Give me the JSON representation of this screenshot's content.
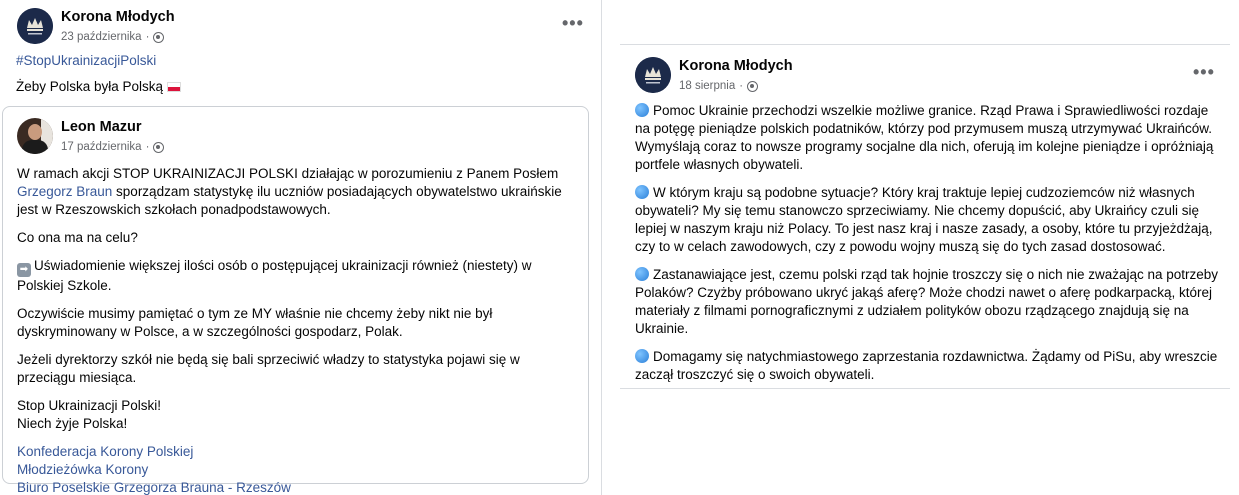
{
  "left_post": {
    "page_name": "Korona Młodych",
    "date": "23 października",
    "more_options": "•••",
    "hashtag": "#StopUkrainizacjiPolski",
    "caption": "Żeby Polska była Polską",
    "shared": {
      "author": "Leon Mazur",
      "date": "17 października",
      "p1_a": "W ramach akcji STOP UKRAINIZACJI POLSKI działając w porozumieniu z Panem Posłem",
      "p1_link": "Grzegorz Braun",
      "p1_b": " sporządzam statystykę ilu uczniów posiadających obywatelstwo ukraińskie jest w Rzeszowskich szkołach ponadpodstawowych.",
      "p2": "Co ona ma na celu?",
      "p3": "Uświadomienie większej ilości osób o postępującej ukrainizacji również (niestety) w Polskiej Szkole.",
      "p4": "Oczywiście musimy pamiętać o tym ze MY właśnie nie chcemy żeby nikt nie był dyskryminowany w Polsce, a w szczególności gospodarz, Polak.",
      "p5": "Jeżeli dyrektorzy szkół nie będą się bali sprzeciwić władzy to statystyka pojawi się w przeciągu miesiąca.",
      "p6a": "Stop Ukrainizacji Polski!",
      "p6b": "Niech żyje Polska!",
      "links": [
        "Konfederacja Korony Polskiej",
        "Młodzieżówka Korony",
        "Biuro Poselskie Grzegorza Brauna - Rzeszów"
      ]
    }
  },
  "right_post": {
    "page_name": "Korona Młodych",
    "date": "18 sierpnia",
    "more_options": "•••",
    "p1": "Pomoc Ukrainie przechodzi wszelkie możliwe granice. Rząd Prawa i Sprawiedliwości rozdaje na potęgę pieniądze polskich podatników, którzy pod przymusem muszą utrzymywać Ukraińców. Wymyślają coraz to nowsze programy socjalne dla nich, oferują im kolejne pieniądze i opróżniają portfele własnych obywateli.",
    "p2": "W którym kraju są podobne sytuacje? Który kraj traktuje lepiej cudzoziemców niż własnych obywateli? My się temu stanowczo sprzeciwiamy. Nie chcemy dopuścić, aby Ukraińcy czuli się lepiej w naszym kraju niż Polacy. To jest nasz kraj i nasze zasady, a osoby, które tu przyjeżdżają, czy to w celach zawodowych, czy z powodu wojny muszą się do tych zasad dostosować.",
    "p3": "Zastanawiające jest, czemu polski rząd tak hojnie troszczy się o nich nie zważając na potrzeby Polaków? Czyżby próbowano ukryć jakąś aferę? Może chodzi nawet o aferę podkarpacką, której materiały z filmami pornograficznymi z udziałem polityków obozu rządzącego znajdują się na Ukrainie.",
    "p4": "Domagamy się natychmiastowego zaprzestania rozdawnictwa. Żądamy od PiSu, aby wreszcie zaczął troszczyć się o swoich obywateli."
  }
}
